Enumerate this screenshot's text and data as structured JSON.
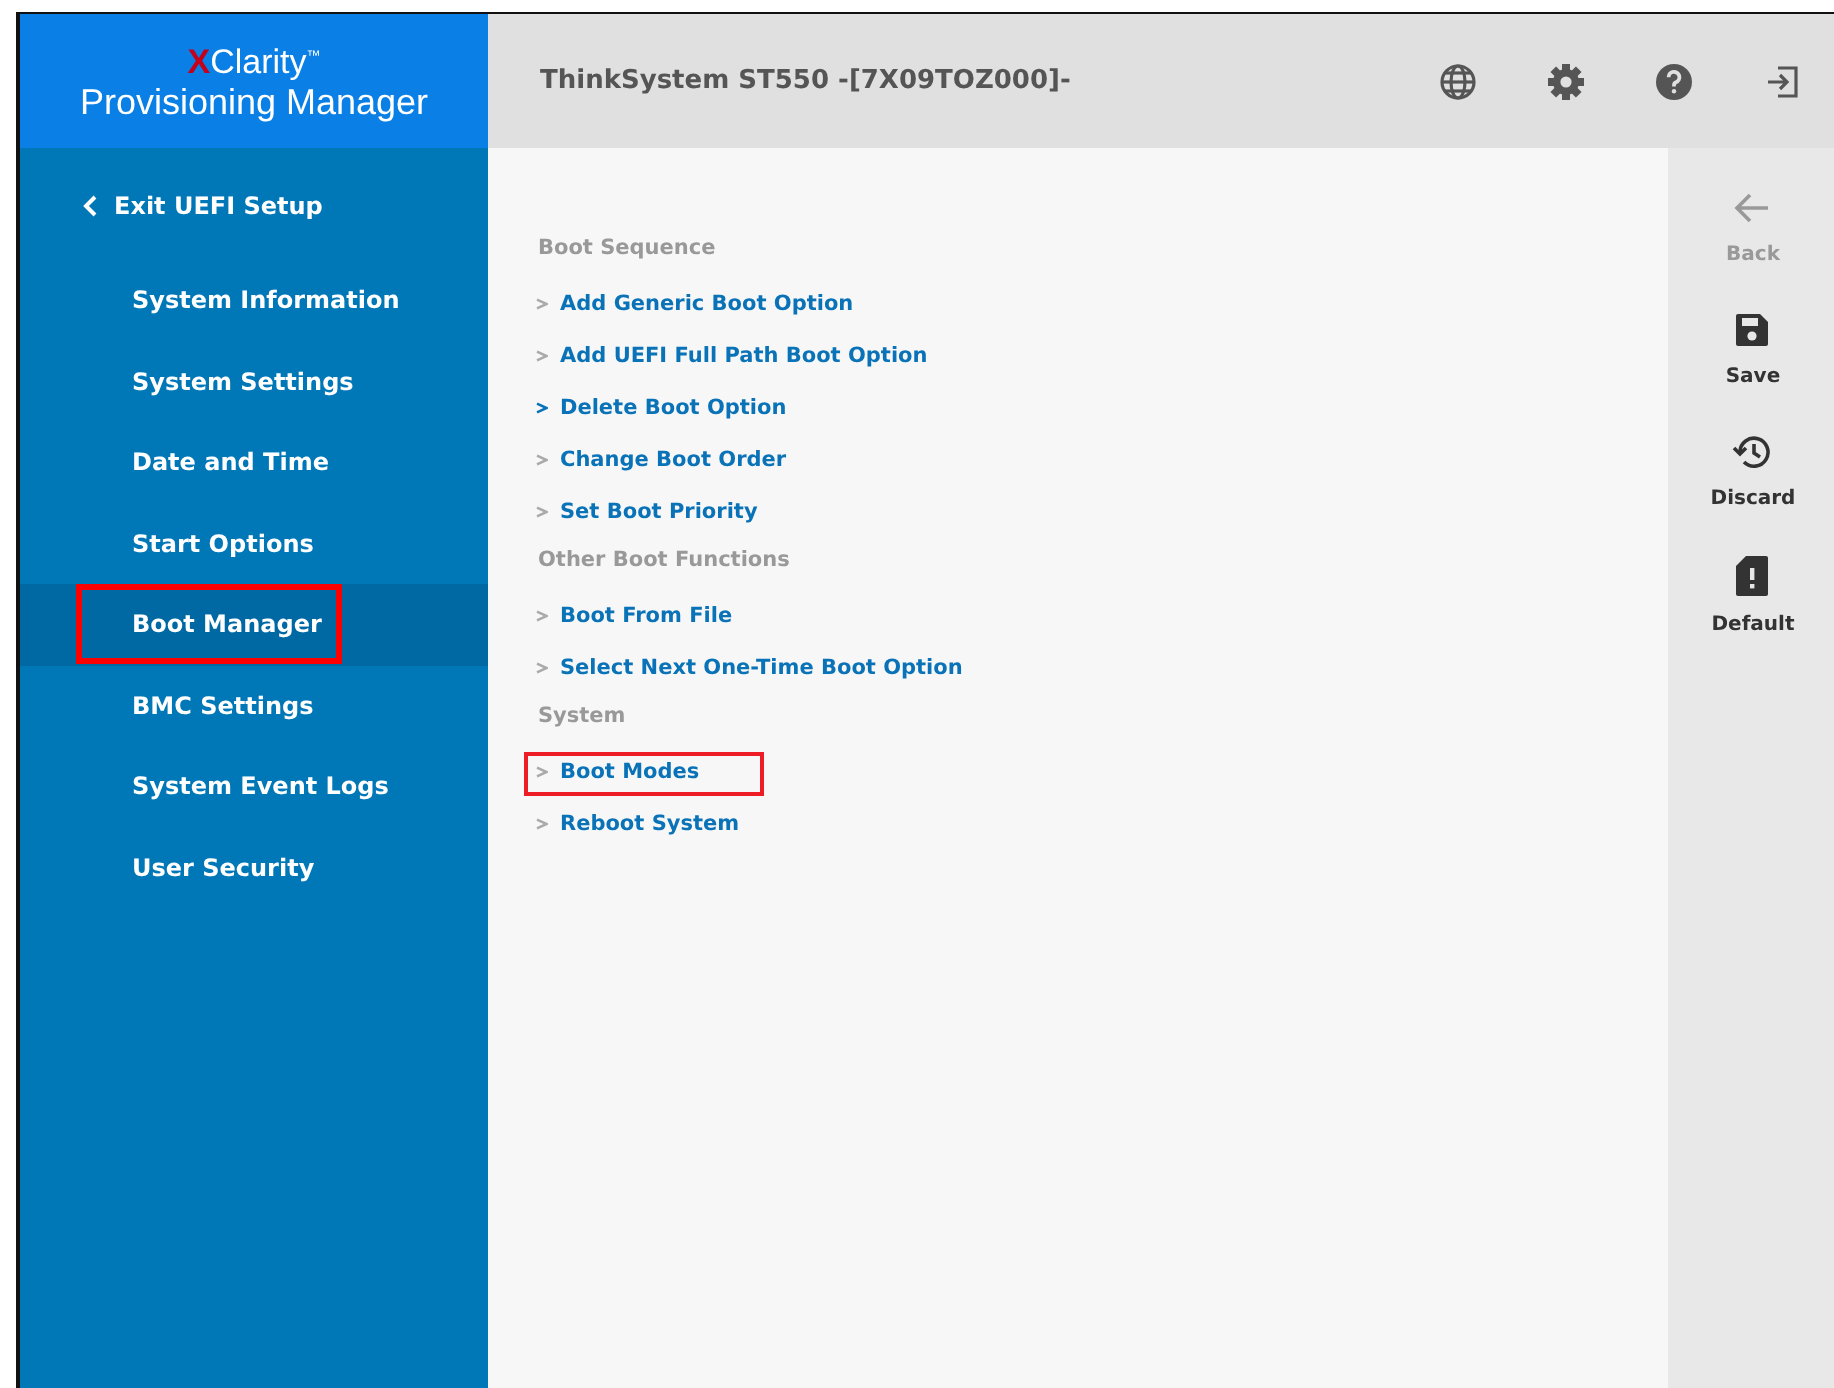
{
  "logo": {
    "initial": "X",
    "rest": "Clarity",
    "mark": "™",
    "product": "Provisioning Manager"
  },
  "header": {
    "title": "ThinkSystem ST550 -[7X09TOZ000]-"
  },
  "sidebar": {
    "back": "Exit UEFI Setup",
    "items": [
      {
        "label": "System Information",
        "selected": false,
        "highlighted": false
      },
      {
        "label": "System Settings",
        "selected": false,
        "highlighted": false
      },
      {
        "label": "Date and Time",
        "selected": false,
        "highlighted": false
      },
      {
        "label": "Start Options",
        "selected": false,
        "highlighted": false
      },
      {
        "label": "Boot Manager",
        "selected": true,
        "highlighted": true
      },
      {
        "label": "BMC Settings",
        "selected": false,
        "highlighted": false
      },
      {
        "label": "System Event Logs",
        "selected": false,
        "highlighted": false
      },
      {
        "label": "User Security",
        "selected": false,
        "highlighted": false
      }
    ]
  },
  "content": [
    {
      "kind": "heading",
      "label": "Boot Sequence"
    },
    {
      "kind": "link",
      "label": "Add Generic Boot Option",
      "focused": false,
      "highlighted": false
    },
    {
      "kind": "link",
      "label": "Add UEFI Full Path Boot Option",
      "focused": false,
      "highlighted": false
    },
    {
      "kind": "link",
      "label": "Delete Boot Option",
      "focused": true,
      "highlighted": false
    },
    {
      "kind": "link",
      "label": "Change Boot Order",
      "focused": false,
      "highlighted": false
    },
    {
      "kind": "link",
      "label": "Set Boot Priority",
      "focused": false,
      "highlighted": false
    },
    {
      "kind": "heading",
      "label": "Other Boot Functions"
    },
    {
      "kind": "link",
      "label": "Boot From File",
      "focused": false,
      "highlighted": false
    },
    {
      "kind": "link",
      "label": "Select Next One-Time Boot Option",
      "focused": false,
      "highlighted": false
    },
    {
      "kind": "heading",
      "label": "System"
    },
    {
      "kind": "link",
      "label": "Boot Modes",
      "focused": false,
      "highlighted": true
    },
    {
      "kind": "link",
      "label": "Reboot System",
      "focused": false,
      "highlighted": false
    }
  ],
  "actions": [
    {
      "kind": "back",
      "label": "Back",
      "disabled": true
    },
    {
      "kind": "save",
      "label": "Save",
      "disabled": false
    },
    {
      "kind": "discard",
      "label": "Discard",
      "disabled": false
    },
    {
      "kind": "default",
      "label": "Default",
      "disabled": false
    }
  ]
}
